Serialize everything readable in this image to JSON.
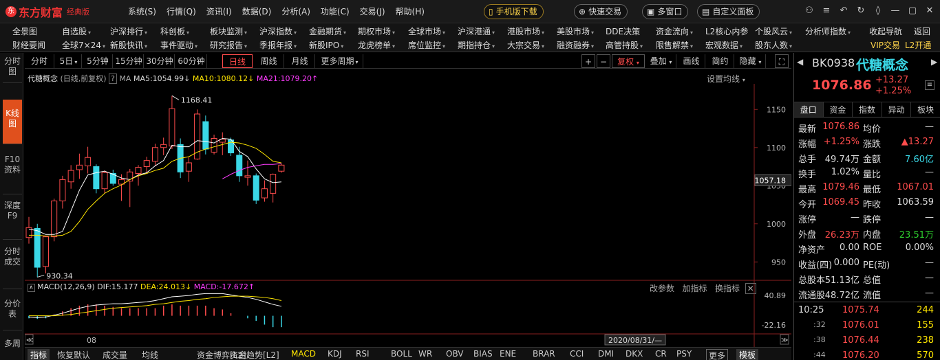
{
  "app": {
    "brand": "东方财富",
    "edition": "经典版"
  },
  "menu": [
    "系统(S)",
    "行情(Q)",
    "资讯(I)",
    "数据(D)",
    "分析(A)",
    "功能(C)",
    "交易(J)",
    "帮助(H)"
  ],
  "top_buttons": {
    "mobile": "手机版下载",
    "quick_trade": "快速交易",
    "multi_window": "多窗口",
    "custom_panel": "自定义面板"
  },
  "nav_row1": [
    "全景图",
    "自选股",
    "沪深排行",
    "科创板",
    "板块监测",
    "沪深指数",
    "金融期货",
    "期权市场",
    "全球市场",
    "沪深港通",
    "港股市场",
    "美股市场",
    "DDE决策",
    "资金流向",
    "L2核心内参",
    "个股风云",
    "分析师指数",
    "收起导航",
    "返回"
  ],
  "nav_row2": [
    "财经要闻",
    "全球7×24",
    "新股快讯",
    "事件驱动",
    "研究报告",
    "季报年报",
    "新股IPO",
    "龙虎榜单",
    "席位监控",
    "期指持仓",
    "大宗交易",
    "融资融券",
    "高管持股",
    "限售解禁",
    "宏观数据",
    "股东人数",
    "VIP交易",
    "L2开通"
  ],
  "left_tabs": [
    "分时图",
    "K线图",
    "F10资料",
    "深度F9",
    "分时成交",
    "分价表",
    "多周"
  ],
  "periods": [
    "分时",
    "5日",
    "5分钟",
    "15分钟",
    "30分钟",
    "60分钟",
    "日线",
    "周线",
    "月线",
    "更多周期"
  ],
  "chart_tools": {
    "fuquan": "复权",
    "overlay": "叠加",
    "draw": "画线",
    "simple": "简约",
    "hide": "隐藏",
    "settings": "设置均线"
  },
  "chart_info": {
    "name": "代糖概念",
    "sub": "(日线,前复权)",
    "q": "?",
    "ma": "MA",
    "ma5": "MA5:1054.99",
    "ma10": "MA10:1080.12",
    "ma21": "MA21:1079.20"
  },
  "macd_info": {
    "label": "MACD(12,26,9)",
    "dif": "DIF:15.177",
    "dea": "DEA:24.013",
    "macd": "MACD:-17.672",
    "btn_params": "改参数",
    "btn_add": "加指标",
    "btn_switch": "换指标",
    "macd_top": "40.89",
    "macd_bot": "-22.16"
  },
  "chart_data": {
    "type": "candlestick",
    "y_ticks": [
      1150.0,
      1100.0,
      1050.0,
      1000.0,
      950.0
    ],
    "ylim": [
      925,
      1180
    ],
    "price_tag": "1057.18",
    "annot_high": "1168.41",
    "annot_low": "930.34",
    "x_label": "08",
    "date_label": "2020/08/31/—",
    "candles": [
      {
        "o": 982,
        "h": 1009,
        "l": 974,
        "c": 995
      },
      {
        "o": 994,
        "h": 1000,
        "l": 930,
        "c": 943
      },
      {
        "o": 944,
        "h": 984,
        "l": 935,
        "c": 983
      },
      {
        "o": 983,
        "h": 1033,
        "l": 977,
        "c": 1030
      },
      {
        "o": 1030,
        "h": 1063,
        "l": 1020,
        "c": 1058
      },
      {
        "o": 1055,
        "h": 1077,
        "l": 1046,
        "c": 1070
      },
      {
        "o": 1071,
        "h": 1092,
        "l": 1059,
        "c": 1077
      },
      {
        "o": 1076,
        "h": 1101,
        "l": 1066,
        "c": 1087
      },
      {
        "o": 1075,
        "h": 1078,
        "l": 1040,
        "c": 1046
      },
      {
        "o": 1046,
        "h": 1070,
        "l": 1040,
        "c": 1067
      },
      {
        "o": 1066,
        "h": 1071,
        "l": 1050,
        "c": 1053
      },
      {
        "o": 1052,
        "h": 1065,
        "l": 1030,
        "c": 1058
      },
      {
        "o": 1056,
        "h": 1072,
        "l": 1022,
        "c": 1068
      },
      {
        "o": 1066,
        "h": 1077,
        "l": 1050,
        "c": 1074
      },
      {
        "o": 1075,
        "h": 1088,
        "l": 1066,
        "c": 1083
      },
      {
        "o": 1082,
        "h": 1105,
        "l": 1076,
        "c": 1100
      },
      {
        "o": 1100,
        "h": 1113,
        "l": 1090,
        "c": 1104
      },
      {
        "o": 1102,
        "h": 1168,
        "l": 1098,
        "c": 1151
      },
      {
        "o": 1104,
        "h": 1112,
        "l": 1060,
        "c": 1068
      },
      {
        "o": 1069,
        "h": 1087,
        "l": 1055,
        "c": 1080
      },
      {
        "o": 1085,
        "h": 1150,
        "l": 1084,
        "c": 1144
      },
      {
        "o": 1134,
        "h": 1142,
        "l": 1091,
        "c": 1098
      },
      {
        "o": 1094,
        "h": 1117,
        "l": 1091,
        "c": 1112
      },
      {
        "o": 1107,
        "h": 1120,
        "l": 1090,
        "c": 1111
      },
      {
        "o": 1110,
        "h": 1113,
        "l": 1089,
        "c": 1093
      },
      {
        "o": 1090,
        "h": 1101,
        "l": 1055,
        "c": 1063
      },
      {
        "o": 1061,
        "h": 1083,
        "l": 1050,
        "c": 1063
      },
      {
        "o": 1063,
        "h": 1066,
        "l": 1026,
        "c": 1031
      },
      {
        "o": 1034,
        "h": 1057,
        "l": 1029,
        "c": 1046
      },
      {
        "o": 1040,
        "h": 1066,
        "l": 1028,
        "c": 1065
      },
      {
        "o": 1069,
        "h": 1079,
        "l": 1067,
        "c": 1077
      }
    ],
    "ma5": [
      993,
      991,
      986,
      986,
      990,
      1017,
      1044,
      1064,
      1067,
      1069,
      1065,
      1060,
      1058,
      1064,
      1067,
      1076,
      1083,
      1103,
      1101,
      1101,
      1109,
      1108,
      1106,
      1112,
      1111,
      1095,
      1088,
      1072,
      1059,
      1054,
      1055
    ],
    "ma10": [
      985,
      985,
      984,
      984,
      985,
      990,
      1003,
      1019,
      1030,
      1040,
      1046,
      1051,
      1058,
      1063,
      1066,
      1070,
      1073,
      1082,
      1086,
      1088,
      1094,
      1098,
      1101,
      1104,
      1107,
      1106,
      1103,
      1099,
      1091,
      1082,
      1080
    ],
    "ma21": [
      null,
      null,
      null,
      null,
      null,
      null,
      null,
      null,
      null,
      null,
      null,
      null,
      null,
      null,
      null,
      null,
      null,
      null,
      null,
      null,
      null,
      null,
      null,
      1059,
      1065,
      1070,
      1074,
      1076,
      1078,
      1078,
      1079
    ],
    "macd_dif": [
      -2,
      -3,
      -2,
      1,
      4,
      8,
      12,
      15,
      17,
      18,
      19,
      19,
      20,
      21,
      22,
      24,
      27,
      30,
      31,
      32,
      34,
      35,
      35,
      35,
      33,
      31,
      29,
      26,
      22,
      18,
      15
    ],
    "macd_dea": [
      0,
      0,
      0,
      0,
      1,
      2,
      4,
      6,
      8,
      10,
      12,
      13,
      14,
      15,
      16,
      18,
      19,
      21,
      23,
      24,
      26,
      27,
      29,
      30,
      31,
      31,
      31,
      30,
      29,
      27,
      24
    ],
    "macd_hist": [
      -4,
      -5,
      -4,
      2,
      7,
      12,
      16,
      18,
      18,
      16,
      14,
      12,
      12,
      12,
      12,
      12,
      16,
      18,
      16,
      16,
      16,
      16,
      12,
      10,
      4,
      0,
      -4,
      -8,
      -14,
      -18,
      -18
    ]
  },
  "quote": {
    "code": "BK0938",
    "name": "代糖概念",
    "price": "1076.86",
    "change": "+13.27",
    "pct": "+1.25%",
    "tabs": [
      "盘口",
      "资金",
      "指数",
      "异动",
      "板块"
    ],
    "rows": [
      {
        "l1": "最新",
        "v1": "1076.86",
        "c1": "red",
        "l2": "均价",
        "v2": "—",
        "c2": "white"
      },
      {
        "l1": "涨幅",
        "v1": "+1.25%",
        "c1": "red",
        "l2": "涨跌",
        "v2": "▲13.27",
        "c2": "red"
      },
      {
        "l1": "总手",
        "v1": "49.74万",
        "c1": "white",
        "l2": "金额",
        "v2": "7.60亿",
        "c2": "cyan"
      },
      {
        "l1": "换手",
        "v1": "1.02%",
        "c1": "white",
        "l2": "量比",
        "v2": "—",
        "c2": "white"
      },
      {
        "l1": "最高",
        "v1": "1079.46",
        "c1": "red",
        "l2": "最低",
        "v2": "1067.01",
        "c2": "red"
      },
      {
        "l1": "今开",
        "v1": "1069.45",
        "c1": "red",
        "l2": "昨收",
        "v2": "1063.59",
        "c2": "white"
      },
      {
        "l1": "涨停",
        "v1": "—",
        "c1": "white",
        "l2": "跌停",
        "v2": "—",
        "c2": "white"
      },
      {
        "l1": "外盘",
        "v1": "26.23万",
        "c1": "red",
        "l2": "内盘",
        "v2": "23.51万",
        "c2": "green"
      },
      {
        "l1": "净资产",
        "v1": "0.00",
        "c1": "white",
        "l2": "ROE",
        "v2": "0.00%",
        "c2": "white"
      },
      {
        "l1": "收益(四)",
        "v1": "0.000",
        "c1": "white",
        "l2": "PE(动)",
        "v2": "—",
        "c2": "white"
      },
      {
        "l1": "总股本",
        "v1": "51.13亿",
        "c1": "white",
        "l2": "总值",
        "v2": "—",
        "c2": "white"
      },
      {
        "l1": "流通股",
        "v1": "48.72亿",
        "c1": "white",
        "l2": "流值",
        "v2": "—",
        "c2": "white"
      }
    ],
    "ticks": [
      {
        "t": "10:25",
        "p": "1075.74",
        "v": "244"
      },
      {
        "t": ":32",
        "p": "1076.01",
        "v": "155"
      },
      {
        "t": ":38",
        "p": "1076.44",
        "v": "238"
      },
      {
        "t": ":44",
        "p": "1076.20",
        "v": "570"
      }
    ]
  },
  "bottom_tabs": [
    "指标",
    "恢复默认",
    "成交量",
    "均线",
    "资金博弈[L2]",
    "资金趋势[L2]",
    "MACD",
    "KDJ",
    "RSI",
    "BOLL",
    "WR",
    "OBV",
    "BIAS",
    "ENE",
    "BRAR",
    "CCI",
    "DMI",
    "DKX",
    "CR",
    "PSY",
    "更多",
    "模板"
  ],
  "colors": {
    "up": "#ff4c4c",
    "down": "#3ad7e6",
    "ma5": "#ffffff",
    "ma10": "#ffe600",
    "ma21": "#ff3cff",
    "accent": "#e0501d"
  }
}
